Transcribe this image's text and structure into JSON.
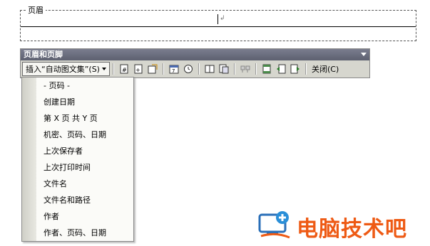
{
  "document": {
    "header_label": "页眉",
    "paragraph_mark": "↲"
  },
  "toolbar": {
    "title": "页眉和页脚",
    "insert_autotext_label": "插入“自动图文集”(S)",
    "close_label": "关闭(C)",
    "icons": [
      "insert-page-number-icon",
      "insert-page-count-icon",
      "format-page-number-icon",
      "insert-date-icon",
      "insert-time-icon",
      "page-setup-icon",
      "show-hide-text-icon",
      "same-as-previous-icon",
      "switch-header-footer-icon",
      "show-previous-icon",
      "show-next-icon"
    ]
  },
  "autotext_menu": {
    "items": [
      "- 页码 -",
      "创建日期",
      "第 X 页 共 Y 页",
      "机密、页码、日期",
      "上次保存者",
      "上次打印时间",
      "文件名",
      "文件名和路径",
      "作者",
      "作者、页码、日期"
    ]
  },
  "watermark": {
    "text": "电脑技术吧",
    "color": "#ee5a14"
  }
}
